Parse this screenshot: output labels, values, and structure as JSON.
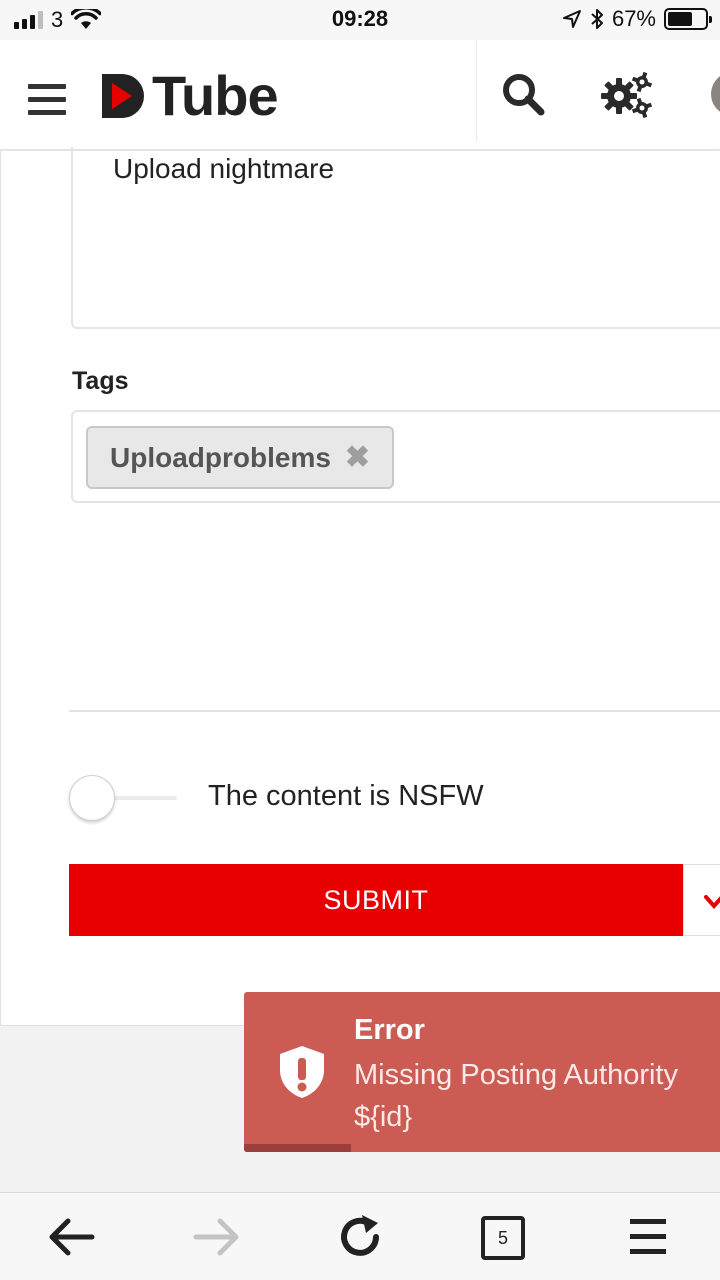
{
  "status_bar": {
    "carrier": "3",
    "time": "09:28",
    "battery_percent_text": "67%",
    "battery_level": 0.67
  },
  "header": {
    "logo_text": "Tube",
    "brand_color": "#e80000",
    "icons": [
      "menu-icon",
      "search-icon",
      "gear-icon",
      "avatar"
    ]
  },
  "form": {
    "description_value": "Upload nightmare",
    "tags_label": "Tags",
    "tags": [
      {
        "label": "Uploadproblems",
        "remove_icon": "close-icon"
      }
    ],
    "nsfw_label": "The content is NSFW",
    "nsfw_enabled": false,
    "submit_label": "SUBMIT"
  },
  "toast": {
    "title": "Error",
    "message": "Missing Posting Authority ${id}",
    "background": "#cc5b54",
    "progress": 0.22
  },
  "browser_bar": {
    "tabs_count": "5",
    "icons": [
      "back-arrow-icon",
      "forward-arrow-icon",
      "reload-icon",
      "tabs-icon",
      "menu-icon"
    ]
  }
}
